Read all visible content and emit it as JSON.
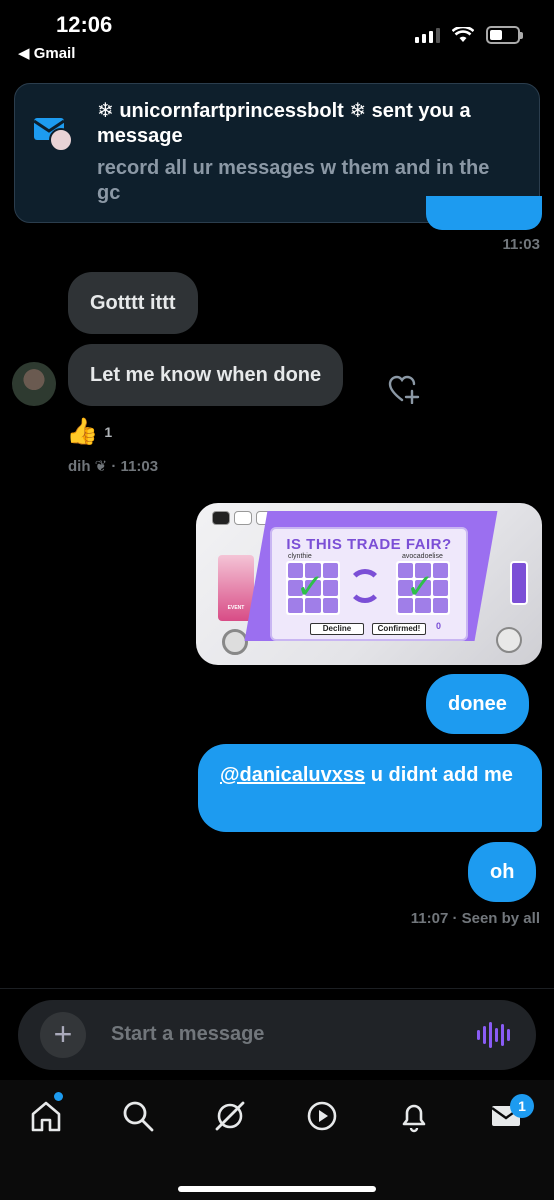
{
  "status": {
    "time": "12:06",
    "back_app": "◀ Gmail"
  },
  "notification": {
    "sender": "❄ unicornfartprincessbolt ❄ sent you a message",
    "message": "record all ur messages w them and in the gc"
  },
  "messages": {
    "t1": "11:03",
    "m1": "Gotttt ittt",
    "m2": "Let me know when done",
    "reaction_emoji": "👍",
    "reaction_count": "1",
    "meta1": "dih ❦ · 11:03",
    "m3": "donee",
    "m4_mention": "@danicaluvxss",
    "m4_rest": " u didnt add me",
    "m5": "oh",
    "meta2": "11:07 · Seen by all"
  },
  "game": {
    "title": "IS THIS TRADE FAIR?",
    "user_left": "clynthie",
    "user_right": "avocadoelise",
    "decline": "Decline",
    "confirmed": "Confirmed!",
    "eye_count": "0"
  },
  "composer": {
    "placeholder": "Start a message"
  },
  "tabbar": {
    "messages_badge": "1"
  },
  "colors": {
    "accent": "#1d9bf0",
    "bubble_in": "#2f3336",
    "voice": "#8a5cf5"
  }
}
